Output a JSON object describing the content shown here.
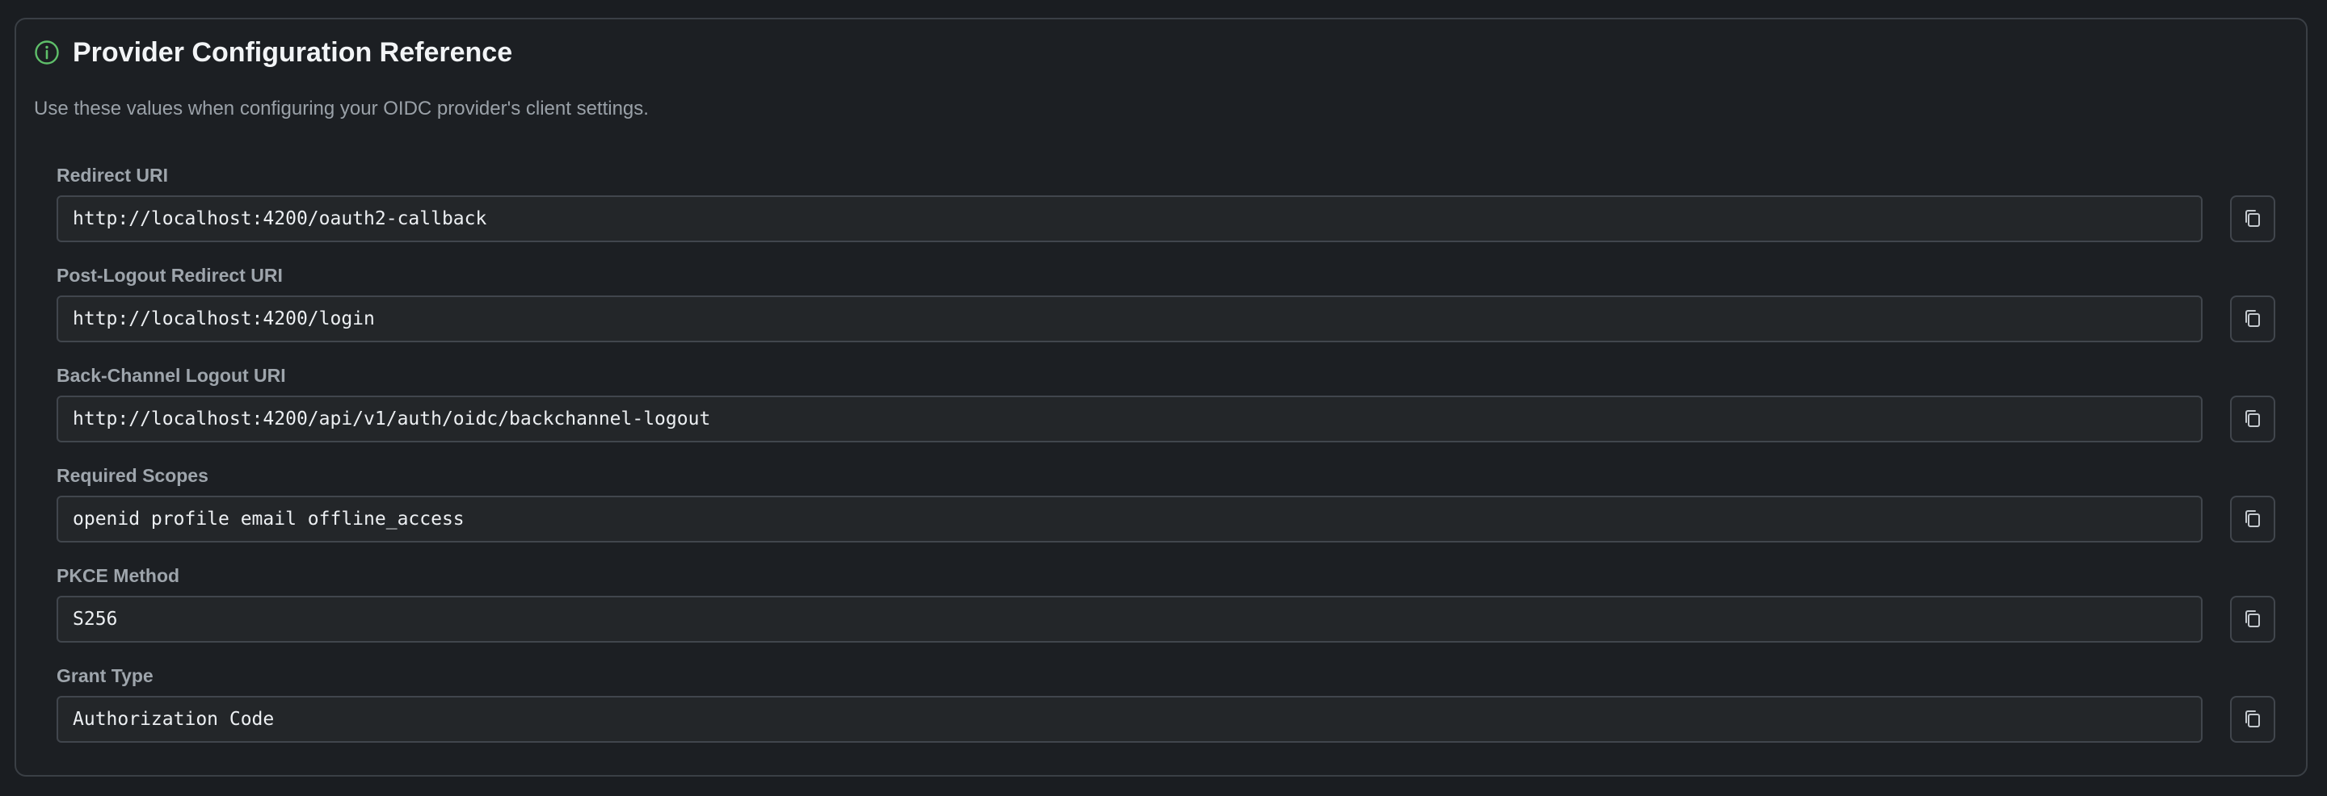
{
  "header": {
    "title": "Provider Configuration Reference",
    "subtitle": "Use these values when configuring your OIDC provider's client settings.",
    "icon": "info-circle-icon",
    "accent_color": "#5fbf6a"
  },
  "fields": [
    {
      "label": "Redirect URI",
      "value": "http://localhost:4200/oauth2-callback",
      "copy_icon": "copy-icon"
    },
    {
      "label": "Post-Logout Redirect URI",
      "value": "http://localhost:4200/login",
      "copy_icon": "copy-icon"
    },
    {
      "label": "Back-Channel Logout URI",
      "value": "http://localhost:4200/api/v1/auth/oidc/backchannel-logout",
      "copy_icon": "copy-icon"
    },
    {
      "label": "Required Scopes",
      "value": "openid profile email offline_access",
      "copy_icon": "copy-icon"
    },
    {
      "label": "PKCE Method",
      "value": "S256",
      "copy_icon": "copy-icon"
    },
    {
      "label": "Grant Type",
      "value": "Authorization Code",
      "copy_icon": "copy-icon"
    }
  ]
}
